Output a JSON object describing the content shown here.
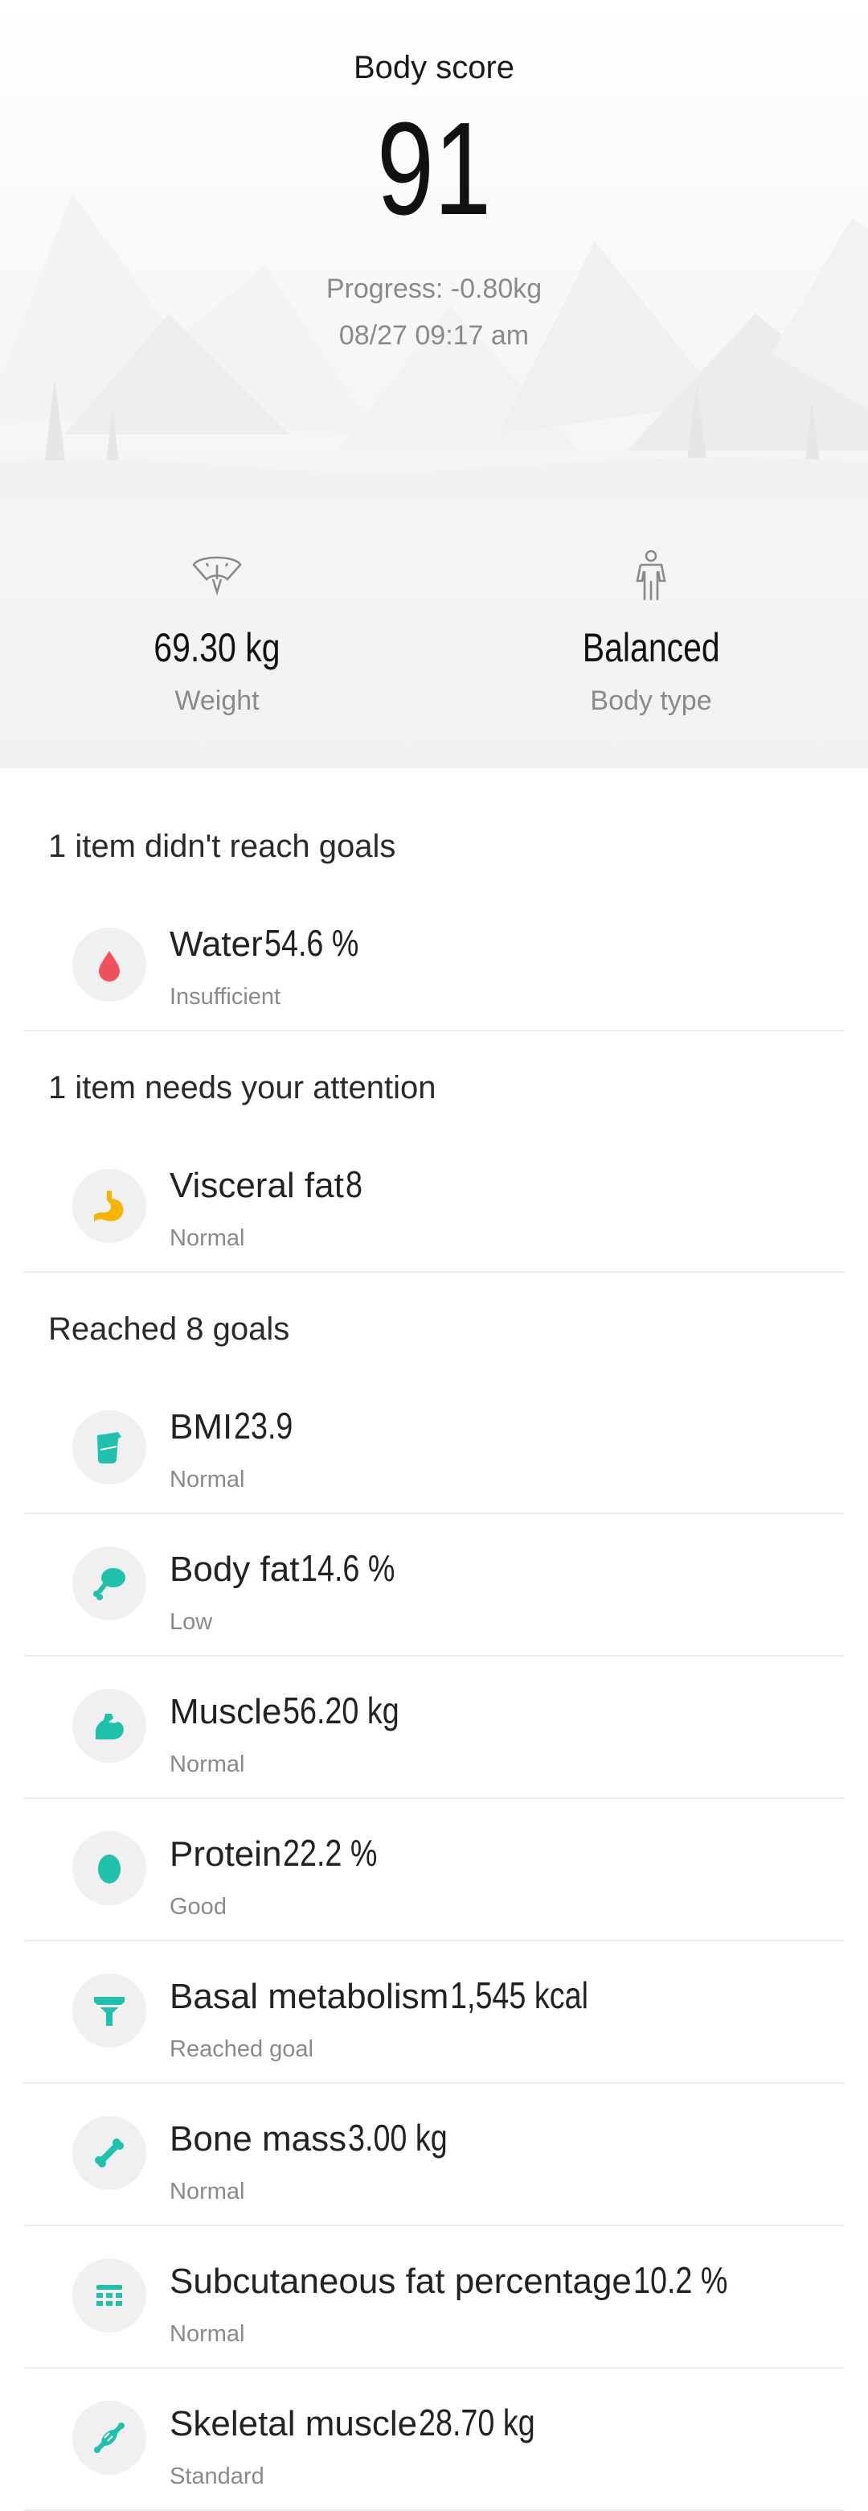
{
  "header": {
    "title": "Body score",
    "score": "91",
    "progress": "Progress: -0.80kg",
    "timestamp": "08/27 09:17 am"
  },
  "summary": {
    "weight": {
      "value": "69.30 kg",
      "label": "Weight",
      "icon": "scale-icon"
    },
    "body_type": {
      "value": "Balanced",
      "label": "Body type",
      "icon": "person-icon"
    }
  },
  "sections": [
    {
      "title": "1 item didn't reach goals"
    },
    {
      "title": "1 item needs your attention"
    },
    {
      "title": "Reached 8 goals"
    }
  ],
  "metrics": [
    {
      "name": "Water",
      "value": "54.6 %",
      "status": "Insufficient",
      "icon": "water-drop-icon",
      "color": "#f0505a"
    },
    {
      "name": "Visceral fat",
      "value": "8",
      "status": "Normal",
      "icon": "stomach-icon",
      "color": "#f5b400"
    },
    {
      "name": "BMI",
      "value": "23.9",
      "status": "Normal",
      "icon": "beaker-icon",
      "color": "#1fc1ad"
    },
    {
      "name": "Body fat",
      "value": "14.6 %",
      "status": "Low",
      "icon": "drumstick-icon",
      "color": "#1fc1ad"
    },
    {
      "name": "Muscle",
      "value": "56.20 kg",
      "status": "Normal",
      "icon": "arm-muscle-icon",
      "color": "#1fc1ad"
    },
    {
      "name": "Protein",
      "value": "22.2 %",
      "status": "Good",
      "icon": "egg-icon",
      "color": "#1fc1ad"
    },
    {
      "name": "Basal metabolism",
      "value": "1,545  kcal",
      "status": "Reached goal",
      "icon": "funnel-icon",
      "color": "#1fc1ad"
    },
    {
      "name": "Bone mass",
      "value": "3.00 kg",
      "status": "Normal",
      "icon": "bone-icon",
      "color": "#1fc1ad"
    },
    {
      "name": "Subcutaneous fat percentage",
      "value": "10.2 %",
      "status": "Normal",
      "icon": "grid-icon",
      "color": "#1fc1ad"
    },
    {
      "name": "Skeletal muscle",
      "value": "28.70 kg",
      "status": "Standard",
      "icon": "skeletal-muscle-icon",
      "color": "#1fc1ad"
    }
  ]
}
